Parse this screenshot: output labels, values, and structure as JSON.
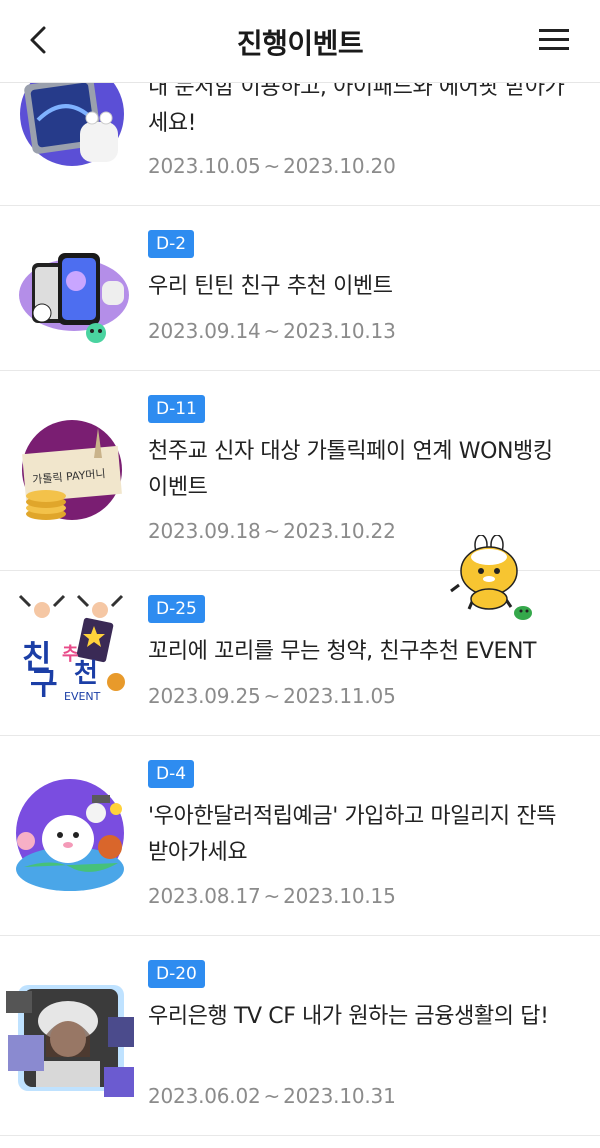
{
  "header": {
    "title": "진행이벤트",
    "back_icon": "chevron-left-icon",
    "menu_icon": "hamburger-menu-icon"
  },
  "events": [
    {
      "badge": "",
      "title": "내 문서함 이용하고, 아이패드와 에어팟 받아가세요!",
      "start": "2023.10.05",
      "end": "2023.10.20"
    },
    {
      "badge": "D-2",
      "title": "우리 틴틴 친구 추천 이벤트",
      "start": "2023.09.14",
      "end": "2023.10.13"
    },
    {
      "badge": "D-11",
      "title": "천주교 신자 대상 가톨릭페이 연계 WON뱅킹 이벤트",
      "start": "2023.09.18",
      "end": "2023.10.22",
      "thumb_text": "가톨릭 PAY머니"
    },
    {
      "badge": "D-25",
      "title": "꼬리에 꼬리를 무는 청약, 친구추천 EVENT",
      "start": "2023.09.25",
      "end": "2023.11.05",
      "thumb_text_1": "친",
      "thumb_text_2": "추",
      "thumb_text_3": "구",
      "thumb_text_4": "천",
      "thumb_text_5": "EVENT"
    },
    {
      "badge": "D-4",
      "title": "'우아한달러적립예금' 가입하고 마일리지 잔뜩 받아가세요",
      "start": "2023.08.17",
      "end": "2023.10.15"
    },
    {
      "badge": "D-20",
      "title": "우리은행 TV CF 내가 원하는 금융생활의 답!",
      "start": "2023.06.02",
      "end": "2023.10.31"
    }
  ],
  "date_separator": "~",
  "colors": {
    "badge": "#2e8cf0",
    "date_text": "#8b8b8b",
    "divider": "#e8e8e8"
  }
}
